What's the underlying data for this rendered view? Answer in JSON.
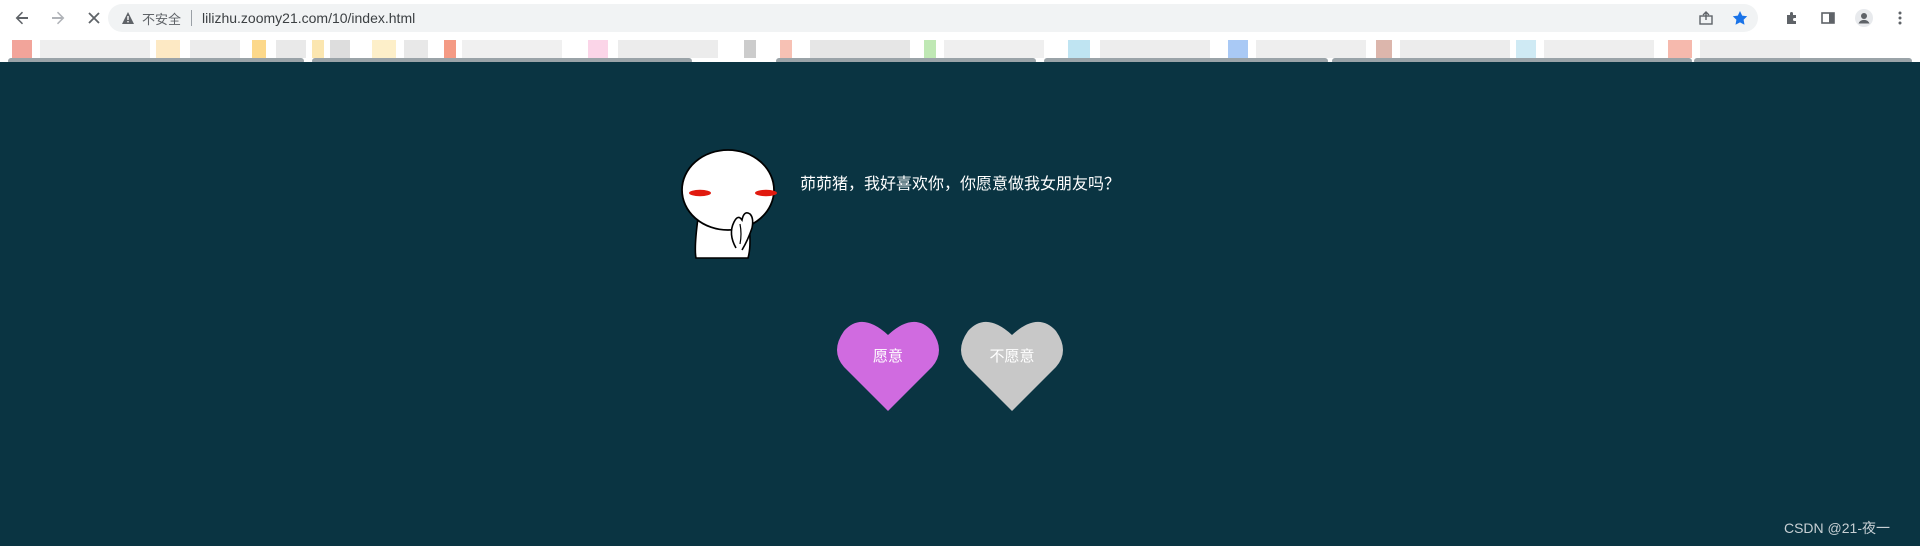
{
  "browser": {
    "security_label": "不安全",
    "url": "lilizhu.zoomy21.com/10/index.html"
  },
  "page": {
    "question": "茆茆猪，我好喜欢你，你愿意做我女朋友吗？",
    "yes_label": "愿意",
    "no_label": "不愿意",
    "watermark": "CSDN @21-夜一"
  },
  "colors": {
    "background": "#0a3442",
    "yes_heart": "#d06be0",
    "no_heart": "#c8c8c8",
    "blush": "#e11a0f"
  }
}
